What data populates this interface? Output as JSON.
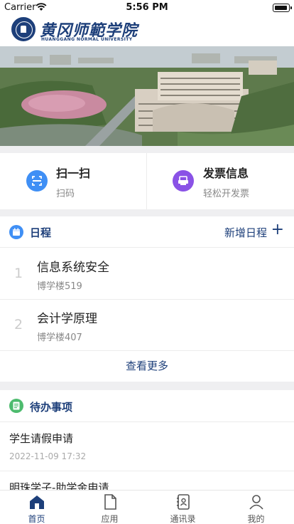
{
  "status_bar": {
    "carrier": "Carrier",
    "time": "5:56 PM"
  },
  "header": {
    "logo_cn": "黄冈师範学院",
    "logo_en": "HUANGGANG NORMAL UNIVERSITY"
  },
  "quick_actions": [
    {
      "title": "扫一扫",
      "subtitle": "扫码",
      "icon": "scan-icon",
      "color": "#3f8ff5"
    },
    {
      "title": "发票信息",
      "subtitle": "轻松开发票",
      "icon": "invoice-icon",
      "color": "#8a52e6"
    }
  ],
  "schedule": {
    "title": "日程",
    "add_label": "新增日程",
    "add_icon": "plus-icon",
    "items": [
      {
        "index": "1",
        "course": "信息系统安全",
        "room": "博学楼519"
      },
      {
        "index": "2",
        "course": "会计学原理",
        "room": "博学楼407"
      }
    ],
    "more_label": "查看更多"
  },
  "todo": {
    "title": "待办事项",
    "items": [
      {
        "name": "学生请假申请",
        "time": "2022-11-09 17:32"
      },
      {
        "name": "明珠学子-助学金申请",
        "time": ""
      }
    ]
  },
  "tabbar": {
    "active_color": "#1d3f7a",
    "items": [
      {
        "label": "首页",
        "icon": "home-icon"
      },
      {
        "label": "应用",
        "icon": "document-icon"
      },
      {
        "label": "通讯录",
        "icon": "contacts-icon"
      },
      {
        "label": "我的",
        "icon": "user-icon"
      }
    ]
  },
  "colors": {
    "brand": "#1d3f7a",
    "accent_blue": "#3f8ff5",
    "accent_green": "#4dbb6e"
  }
}
